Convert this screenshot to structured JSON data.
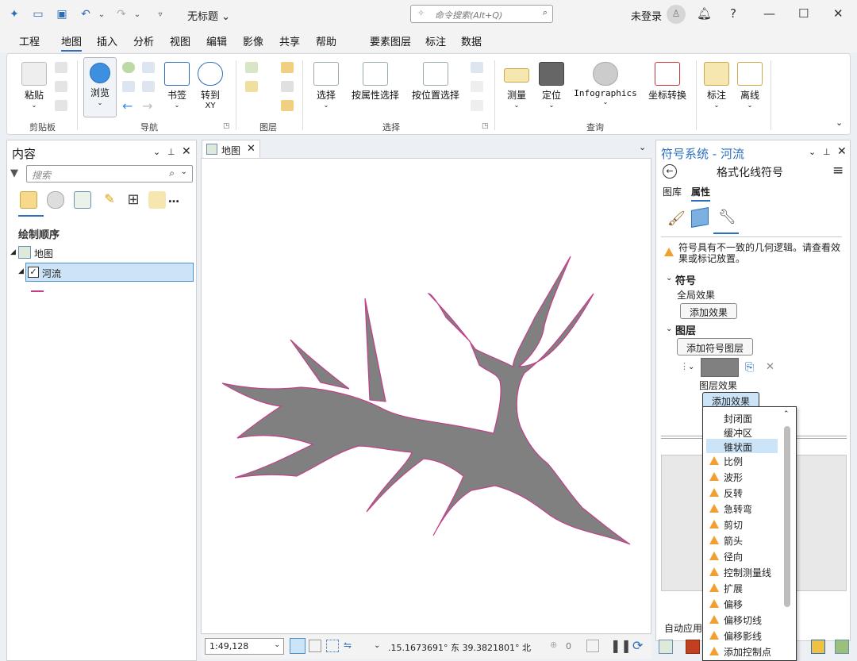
{
  "title": "无标题",
  "command_search": {
    "placeholder": "命令搜索(Alt+Q)"
  },
  "user": {
    "status": "未登录"
  },
  "menu": [
    "工程",
    "地图",
    "插入",
    "分析",
    "视图",
    "编辑",
    "影像",
    "共享",
    "帮助"
  ],
  "contextual_tabs": [
    "要素图层",
    "标注",
    "数据"
  ],
  "ribbon": {
    "paste": "粘贴",
    "clipboard_group": "剪贴板",
    "browse": "浏览",
    "bookmarks": "书签",
    "goto_xy": "转到",
    "goto_xy_sub": "XY",
    "navigate_group": "导航",
    "layer_group": "图层",
    "select": "选择",
    "select_by_attr": "按属性选择",
    "select_by_loc": "按位置选择",
    "selection_group": "选择",
    "measure": "测量",
    "locate": "定位",
    "infographics": "Infographics",
    "coord_convert": "坐标转换",
    "inquiry_group": "查询",
    "label": "标注",
    "offline": "离线"
  },
  "contents": {
    "title": "内容",
    "search_placeholder": "搜索",
    "drawing_order": "绘制顺序",
    "map_node": "地图",
    "layer_node": "河流"
  },
  "map_tab": {
    "label": "地图"
  },
  "status_bar": {
    "scale": "1:49,128",
    "coords": ".15.1673691° 东  39.3821801° 北",
    "selected_count": "0"
  },
  "symbology": {
    "title": "符号系统 - 河流",
    "subtitle": "格式化线符号",
    "tab_gallery": "图库",
    "tab_properties": "属性",
    "warning": "符号具有不一致的几何逻辑。请查看效果或标记放置。",
    "symbol_section": "符号",
    "global_effects": "全局效果",
    "add_effect": "添加效果",
    "layers_section": "图层",
    "add_symbol_layer": "添加符号图层",
    "layer_effects": "图层效果",
    "auto_apply": "自动应用"
  },
  "effects_dropdown": {
    "items": [
      {
        "label": "封闭面",
        "warn": false
      },
      {
        "label": "缓冲区",
        "warn": false
      },
      {
        "label": "锥状面",
        "warn": false,
        "selected": true
      },
      {
        "label": "比例",
        "warn": true
      },
      {
        "label": "波形",
        "warn": true
      },
      {
        "label": "反转",
        "warn": true
      },
      {
        "label": "急转弯",
        "warn": true
      },
      {
        "label": "剪切",
        "warn": true
      },
      {
        "label": "箭头",
        "warn": true
      },
      {
        "label": "径向",
        "warn": true
      },
      {
        "label": "控制测量线",
        "warn": true
      },
      {
        "label": "扩展",
        "warn": true
      },
      {
        "label": "偏移",
        "warn": true
      },
      {
        "label": "偏移切线",
        "warn": true
      },
      {
        "label": "偏移影线",
        "warn": true
      },
      {
        "label": "添加控制点",
        "warn": true
      }
    ]
  },
  "colors": {
    "accent": "#2a6fc0",
    "feature_fill": "#808080",
    "feature_outline": "#c0408a",
    "selection": "#cce4f7"
  }
}
